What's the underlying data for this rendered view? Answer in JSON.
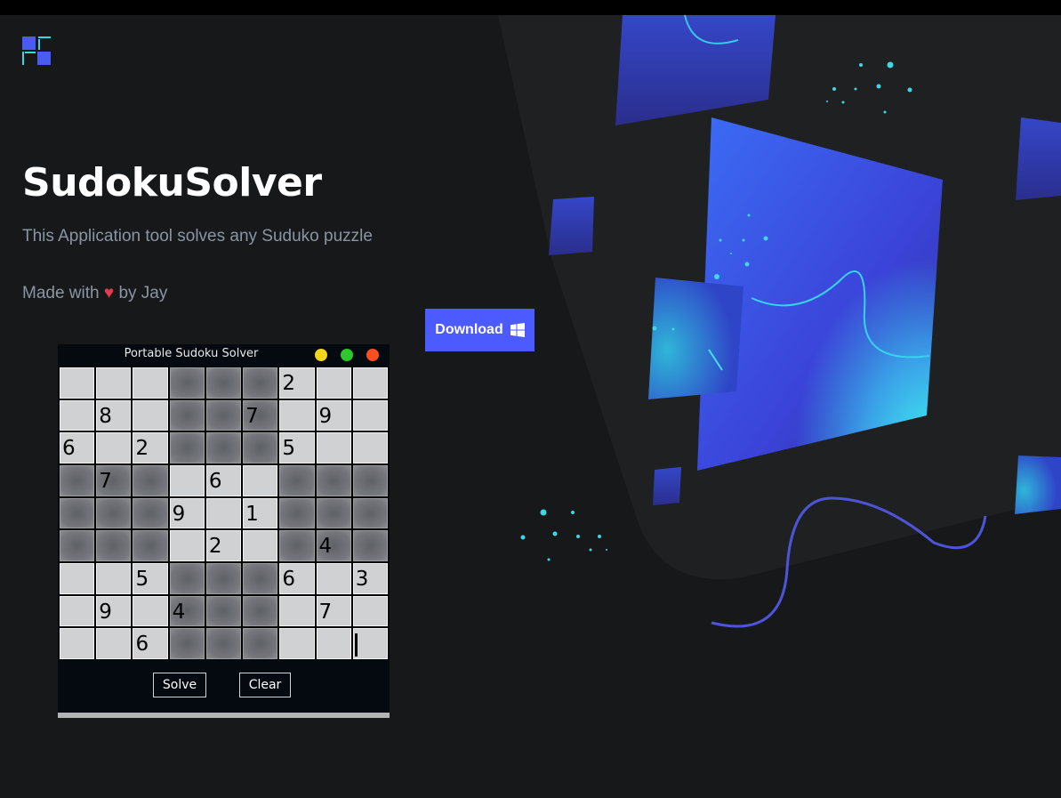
{
  "page": {
    "title": "SudokuSolver",
    "subtitle": "This Application tool solves any Suduko puzzle",
    "made_with_prefix": "Made with",
    "heart": "♥",
    "made_with_suffix": "by Jay",
    "download_label": "Download"
  },
  "icons": {
    "logo": "app-logo-icon",
    "download": "windows-icon"
  },
  "colors": {
    "background": "#17181a",
    "accent": "#4b5bff",
    "heart": "#e23b4a",
    "text_muted": "#8a95a3"
  },
  "app_window": {
    "title": "Portable Sudoku Solver",
    "controls": [
      "minimize",
      "maximize",
      "close"
    ],
    "solve_label": "Solve",
    "clear_label": "Clear",
    "board": [
      [
        "",
        "",
        "",
        "",
        "",
        "",
        "2",
        "",
        ""
      ],
      [
        "",
        "8",
        "",
        "",
        "",
        "7",
        "",
        "9",
        ""
      ],
      [
        "6",
        "",
        "2",
        "",
        "",
        "",
        "5",
        "",
        ""
      ],
      [
        "",
        "7",
        "",
        "",
        "6",
        "",
        "",
        "",
        ""
      ],
      [
        "",
        "",
        "",
        "9",
        "",
        "1",
        "",
        "",
        ""
      ],
      [
        "",
        "",
        "",
        "",
        "2",
        "",
        "",
        "4",
        ""
      ],
      [
        "",
        "",
        "5",
        "",
        "",
        "",
        "6",
        "",
        "3"
      ],
      [
        "",
        "9",
        "",
        "4",
        "",
        "",
        "",
        "7",
        ""
      ],
      [
        "",
        "",
        "6",
        "",
        "",
        "",
        "",
        "",
        ""
      ]
    ],
    "active_cell": [
      8,
      8
    ]
  }
}
